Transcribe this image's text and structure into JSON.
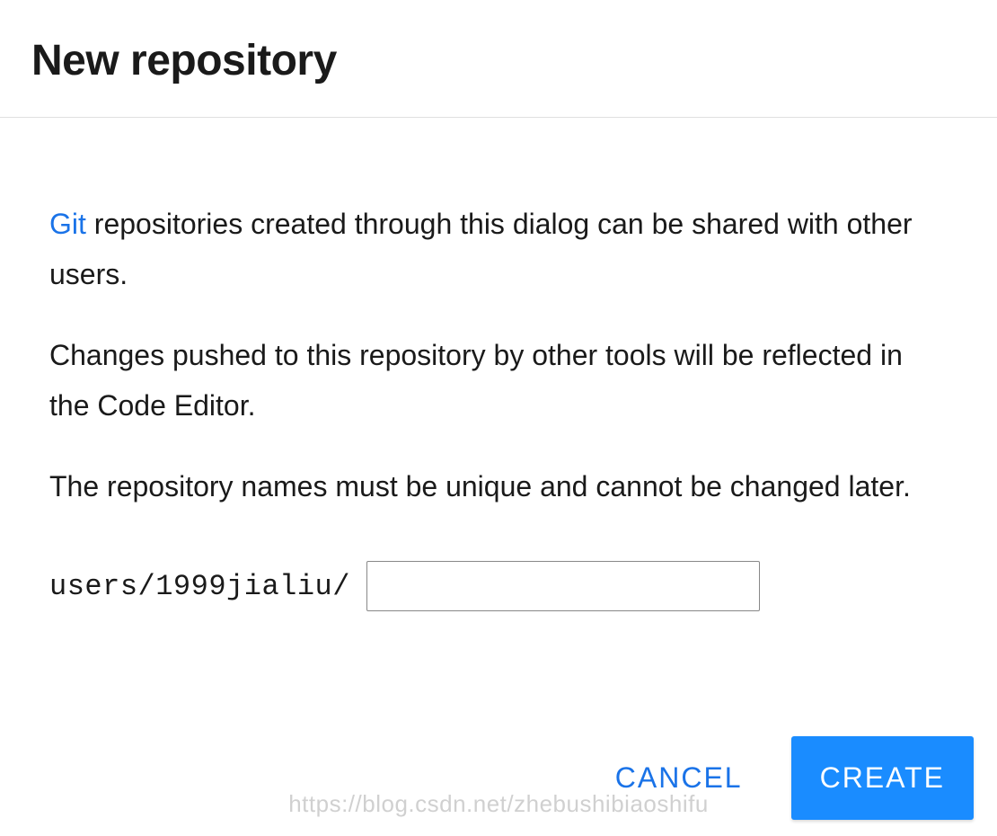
{
  "header": {
    "title": "New repository"
  },
  "content": {
    "git_link_text": "Git",
    "para1_rest": " repositories created through this dialog can be shared with other users.",
    "para2": "Changes pushed to this repository by other tools will be reflected in the Code Editor.",
    "para3": "The repository names must be unique and cannot be changed later.",
    "repo_prefix": "users/1999jialiu/",
    "repo_name_value": ""
  },
  "footer": {
    "cancel_label": "CANCEL",
    "create_label": "CREATE"
  },
  "watermark": "https://blog.csdn.net/zhebushibiaoshifu",
  "colors": {
    "link": "#1a73e8",
    "primary_button": "#1a8cff"
  }
}
